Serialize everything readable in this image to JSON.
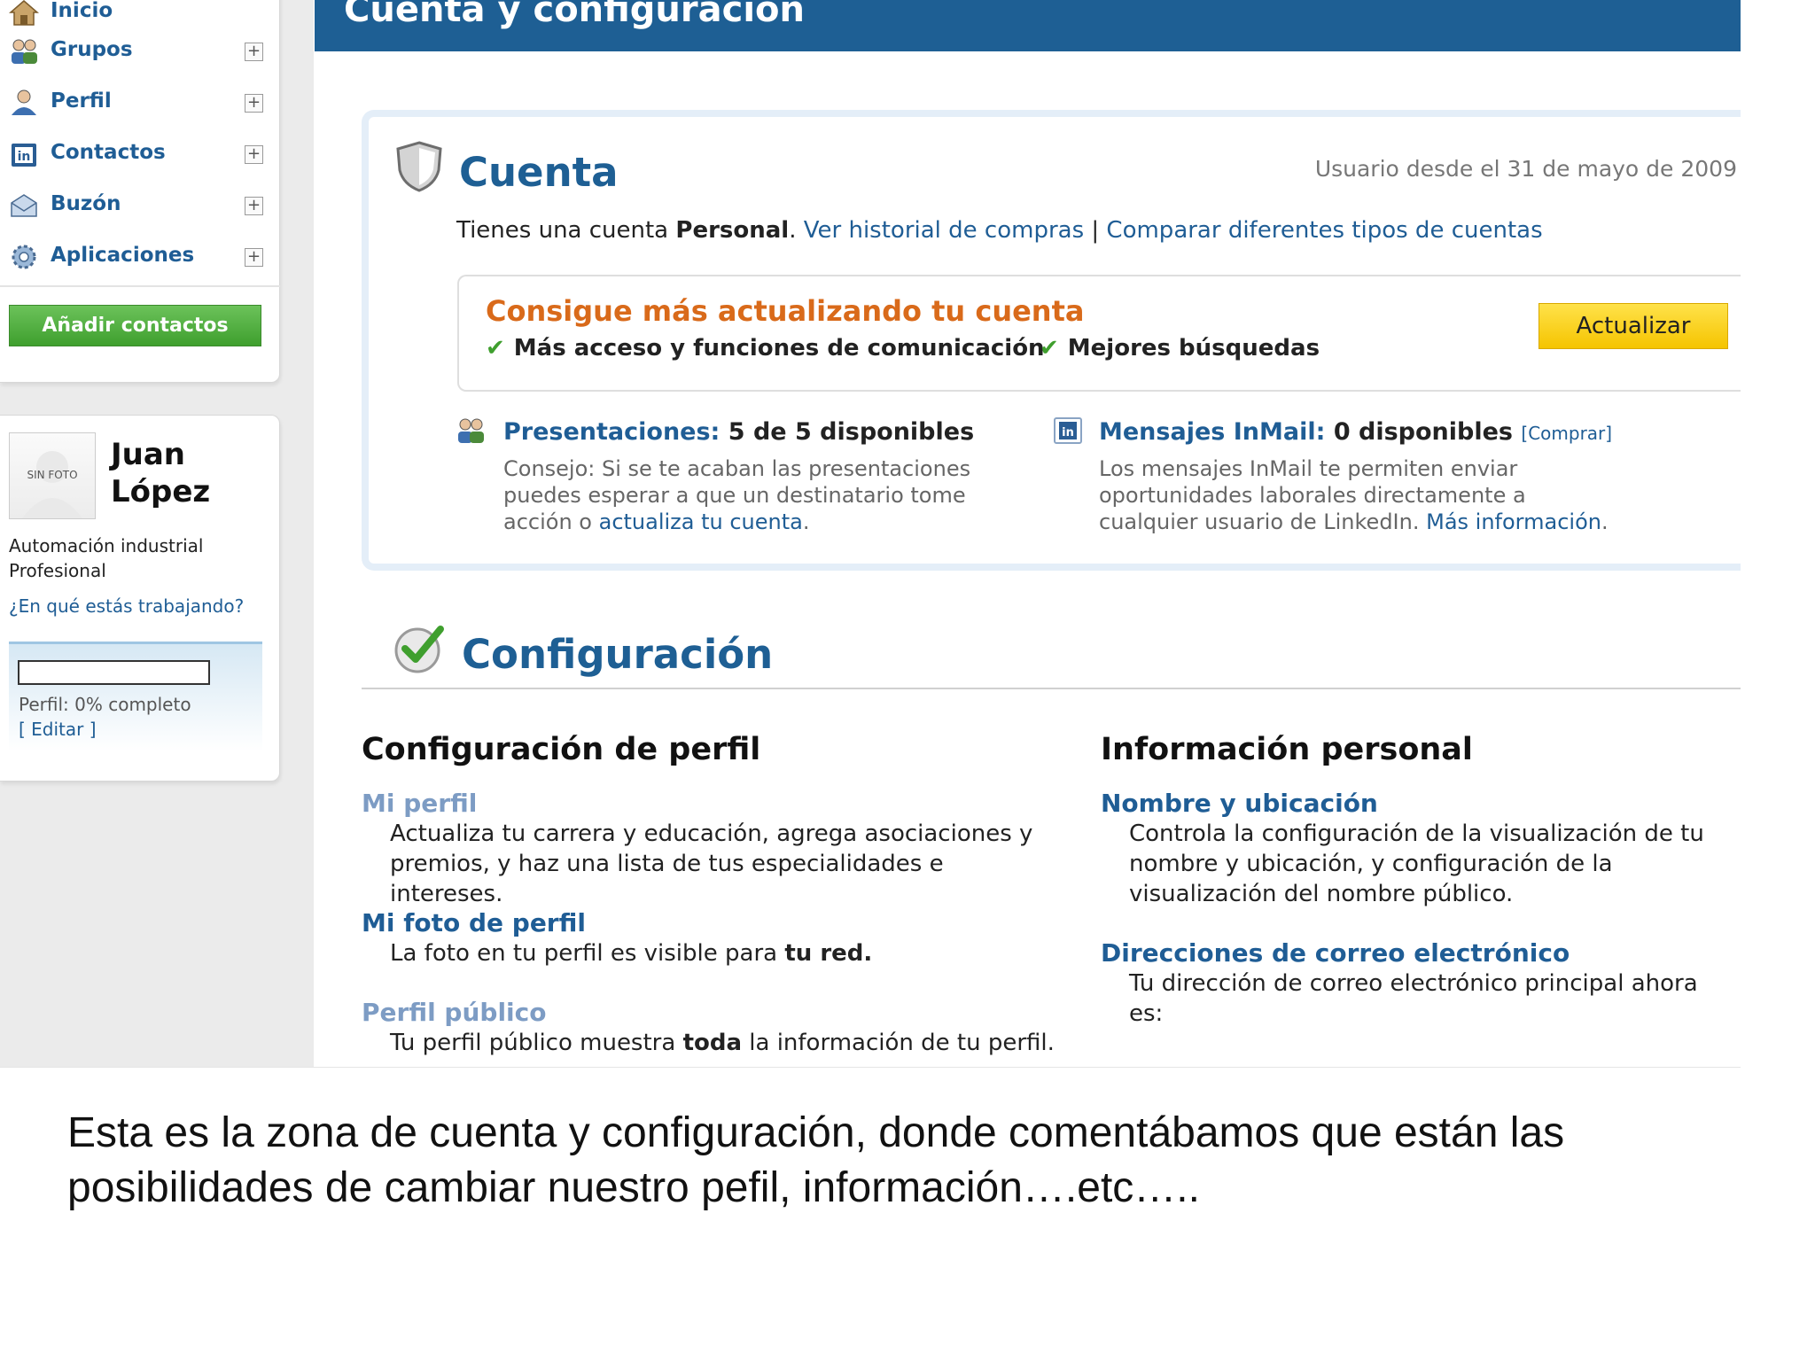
{
  "sidebar": {
    "nav": [
      {
        "label": "Inicio",
        "icon": "home-icon"
      },
      {
        "label": "Grupos",
        "icon": "groups-icon"
      },
      {
        "label": "Perfil",
        "icon": "profile-icon"
      },
      {
        "label": "Contactos",
        "icon": "contacts-icon"
      },
      {
        "label": "Buzón",
        "icon": "inbox-icon"
      },
      {
        "label": "Aplicaciones",
        "icon": "applications-icon"
      }
    ],
    "expand_symbol": "+",
    "add_contacts_label": "Añadir contactos",
    "profile": {
      "photo_label": "SIN FOTO",
      "name": "Juan López",
      "headline_line1": "Automación industrial",
      "headline_line2": "Profesional",
      "working_on_link": "¿En qué estás trabajando?",
      "completeness": 0,
      "completeness_text": "Perfil: 0% completo",
      "edit_link": "[ Editar ]"
    }
  },
  "header": {
    "title": "Cuenta y configuración"
  },
  "cuenta": {
    "title": "Cuenta",
    "member_since": "Usuario desde el 31 de mayo de 2009",
    "account_prefix": "Tienes una cuenta ",
    "account_type": "Personal",
    "account_suffix": ". ",
    "history_link": "Ver historial de compras",
    "separator": " | ",
    "compare_link": "Comparar diferentes tipos de cuentas",
    "upgrade": {
      "title": "Consigue más actualizando tu cuenta",
      "benefit1": "Más acceso y funciones de comunicación",
      "benefit2": "Mejores búsquedas",
      "check_symbol": "✔",
      "button_label": "Actualizar"
    },
    "introductions": {
      "title": "Presentaciones:",
      "value": "5 de 5 disponibles",
      "tip_text": "Consejo: Si se te acaban las presentaciones puedes esperar a que un destinatario tome acción o ",
      "tip_link": "actualiza tu cuenta",
      "tip_end": "."
    },
    "inmail": {
      "title": "Mensajes InMail:",
      "value": "0 disponibles",
      "buy_link": "[Comprar]",
      "text": "Los mensajes InMail te permiten enviar oportunidades laborales directamente a cualquier usuario de LinkedIn. ",
      "more_link": "Más información",
      "end": "."
    }
  },
  "configuracion": {
    "title": "Configuración",
    "profile_settings": {
      "heading": "Configuración de perfil",
      "items": [
        {
          "title": "Mi perfil",
          "desc": "Actualiza tu carrera y educación, agrega asociaciones y premios, y haz una lista de tus especialidades e intereses."
        },
        {
          "title": "Mi foto de perfil",
          "desc_prefix": "La foto en tu perfil es visible para ",
          "desc_bold": "tu red."
        },
        {
          "title": "Perfil público",
          "desc_prefix": "Tu perfil público muestra ",
          "desc_bold": "toda",
          "desc_suffix": " la información de tu perfil."
        }
      ]
    },
    "personal_info": {
      "heading": "Información personal",
      "items": [
        {
          "title": "Nombre y ubicación",
          "desc": "Controla la configuración de la visualización de tu nombre y ubicación, y configuración de la visualización del nombre público."
        },
        {
          "title": "Direcciones de correo electrónico",
          "desc": "Tu dirección de correo electrónico principal ahora es:"
        }
      ]
    }
  },
  "caption": "Esta es la zona de cuenta y configuración, donde comentábamos que están las posibilidades de cambiar nuestro pefil, información….etc…..",
  "colors": {
    "brand_blue": "#1e5f94",
    "link_blue": "#1f5d95",
    "upgrade_orange": "#d96a1a",
    "button_yellow": "#f5c400",
    "add_green": "#3f9f2e"
  }
}
